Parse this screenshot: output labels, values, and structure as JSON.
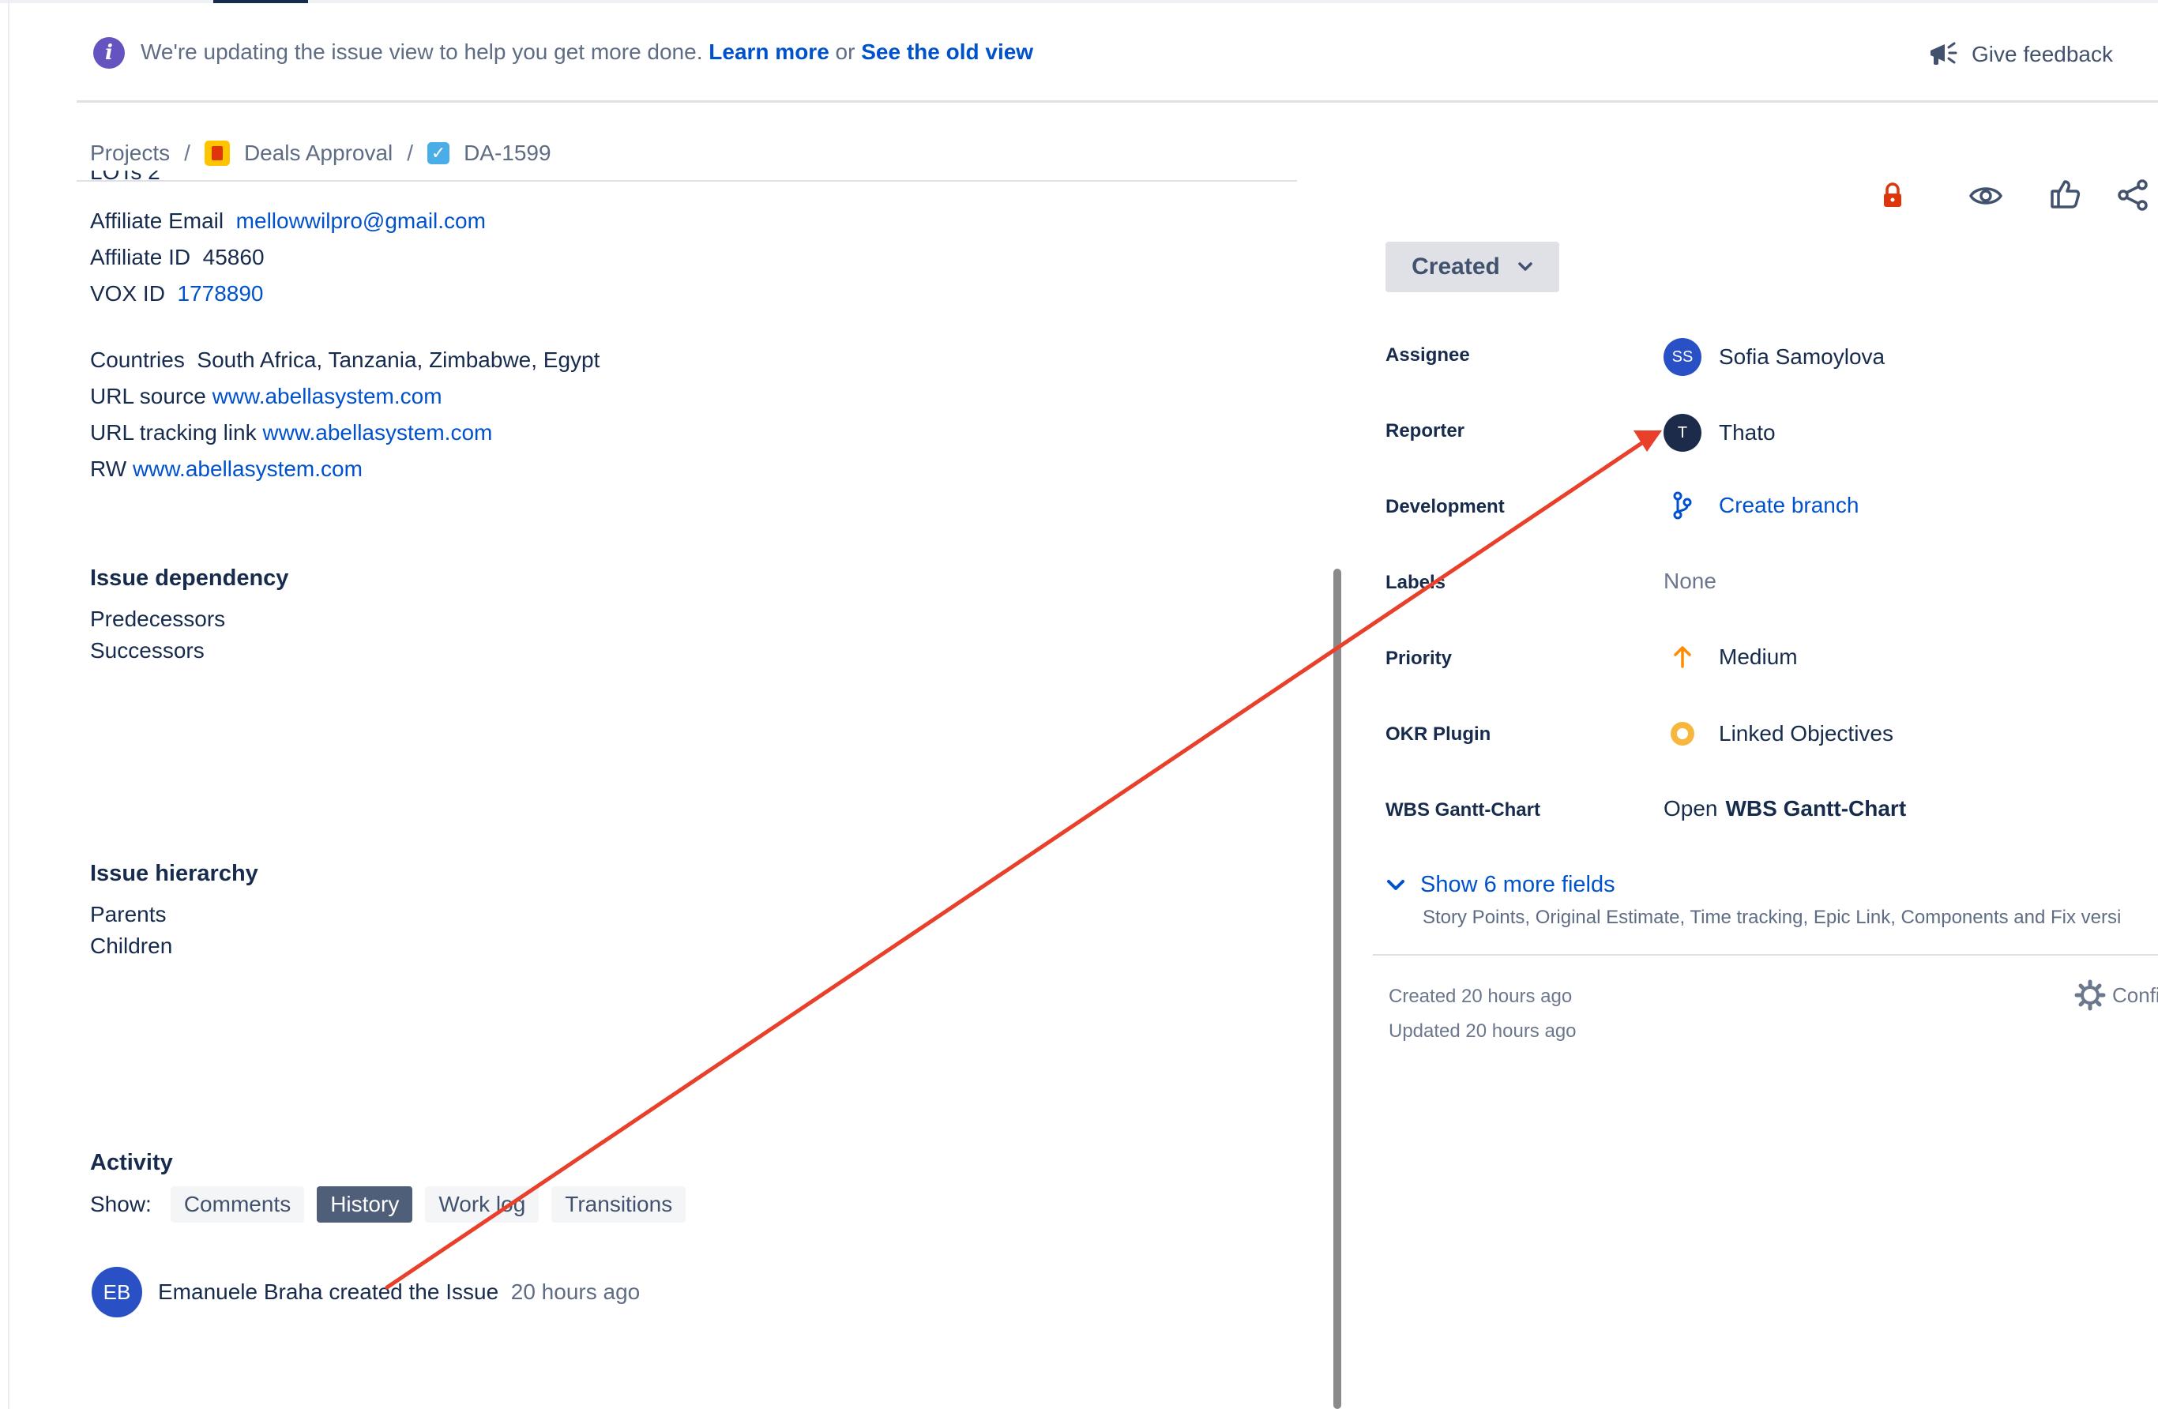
{
  "banner": {
    "message": "We're updating the issue view to help you get more done.",
    "learn_more": "Learn more",
    "or": "or",
    "old_view": "See the old view",
    "feedback": "Give feedback"
  },
  "breadcrumb": {
    "projects": "Projects",
    "separator": "/",
    "project": "Deals Approval",
    "issue_key": "DA-1599"
  },
  "description": {
    "clipped_line": "LOTs 2",
    "affiliate_email_label": "Affiliate Email",
    "affiliate_email": "mellowwilpro@gmail.com",
    "affiliate_id_label": "Affiliate ID",
    "affiliate_id": "45860",
    "vox_id_label": "VOX ID",
    "vox_id": "1778890",
    "countries_label": "Countries",
    "countries": "South Africa, Tanzania, Zimbabwe, Egypt",
    "url_source_label": "URL source",
    "url_source": "www.abellasystem.com",
    "url_tracking_label": "URL tracking link",
    "url_tracking": "www.abellasystem.com",
    "rw_label": "RW",
    "rw": "www.abellasystem.com"
  },
  "dependency": {
    "title": "Issue dependency",
    "predecessors": "Predecessors",
    "successors": "Successors"
  },
  "hierarchy": {
    "title": "Issue hierarchy",
    "parents": "Parents",
    "children": "Children"
  },
  "activity": {
    "title": "Activity",
    "show_label": "Show:",
    "tabs": [
      "Comments",
      "History",
      "Work log",
      "Transitions"
    ],
    "active_tab": "History",
    "entry": {
      "initials": "EB",
      "user": "Emanuele Braha",
      "action": "created the",
      "object": "Issue",
      "time": "20 hours ago"
    }
  },
  "status": {
    "label": "Created"
  },
  "fields": {
    "assignee": {
      "label": "Assignee",
      "initials": "SS",
      "value": "Sofia Samoylova"
    },
    "reporter": {
      "label": "Reporter",
      "initials": "T",
      "value": "Thato"
    },
    "development": {
      "label": "Development",
      "value": "Create branch"
    },
    "labels": {
      "label": "Labels",
      "value": "None"
    },
    "priority": {
      "label": "Priority",
      "value": "Medium"
    },
    "okr": {
      "label": "OKR Plugin",
      "value": "Linked Objectives"
    },
    "wbs": {
      "label": "WBS Gantt-Chart",
      "prefix": "Open",
      "value": "WBS Gantt-Chart"
    }
  },
  "more_fields": {
    "label": "Show 6 more fields",
    "sub": "Story Points, Original Estimate, Time tracking, Epic Link, Components and Fix versi"
  },
  "meta": {
    "created": "Created 20 hours ago",
    "updated": "Updated 20 hours ago",
    "configure": "Confi"
  },
  "colors": {
    "link": "#0052cc",
    "annotation_arrow": "#e8402a",
    "lock": "#de350b",
    "priority_medium": "#ff8b00",
    "okr_ring": "#f6b73c",
    "avatar_blue": "#2950c5",
    "avatar_dark": "#1d2b4a"
  }
}
